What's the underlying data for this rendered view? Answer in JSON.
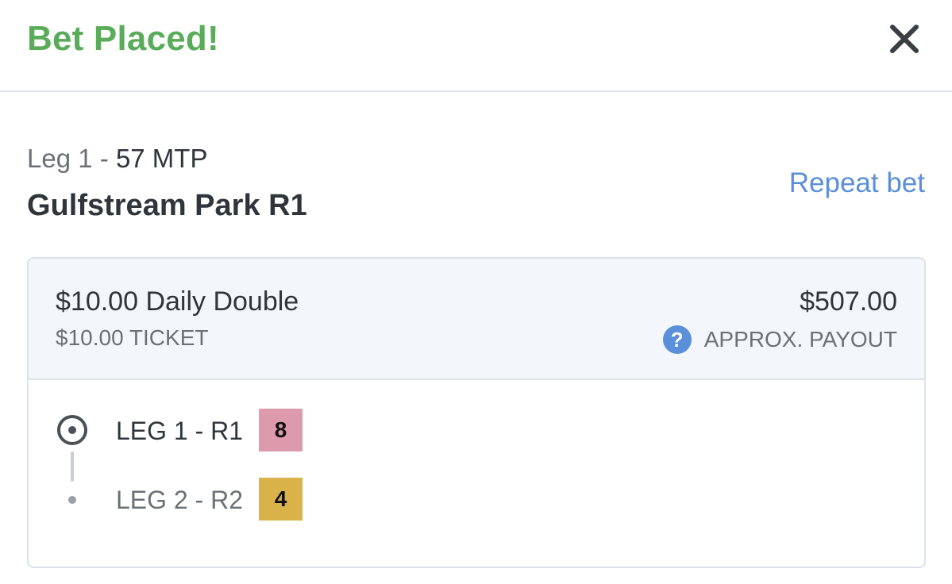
{
  "header": {
    "title": "Bet Placed!",
    "close_icon": "close-icon",
    "title_color": "#5aac5b"
  },
  "race": {
    "leg": "Leg 1",
    "separator": "-",
    "mtp": "57 MTP",
    "name": "Gulfstream Park R1",
    "repeat_label": "Repeat bet"
  },
  "bet": {
    "description": "$10.00 Daily Double",
    "ticket": "$10.00 TICKET",
    "payout": "$507.00",
    "payout_label": "APPROX. PAYOUT",
    "help_glyph": "?",
    "accent_color": "#5b8fd9"
  },
  "legs": [
    {
      "label": "LEG 1 - R1",
      "selection": "8",
      "badge_color": "#dc9aac",
      "active": true
    },
    {
      "label": "LEG 2 - R2",
      "selection": "4",
      "badge_color": "#d9b24a",
      "active": false
    }
  ]
}
